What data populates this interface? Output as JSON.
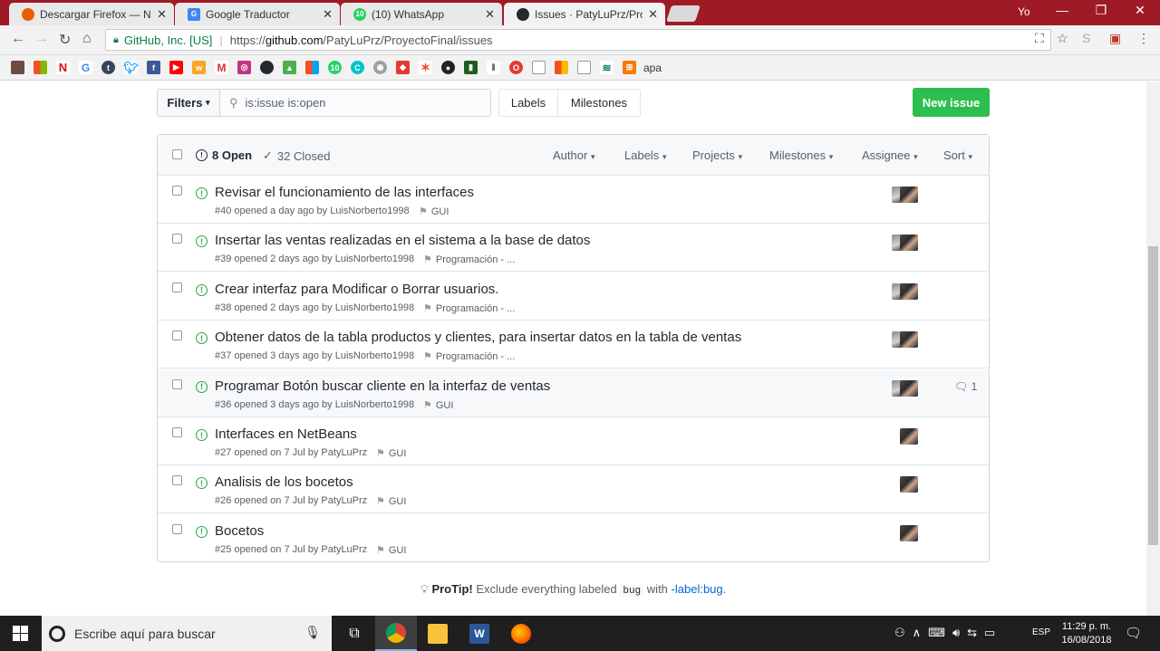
{
  "browser": {
    "tabs": [
      {
        "title": "Descargar Firefox — Nav",
        "icon": "firefox-icon",
        "color": "#e66000"
      },
      {
        "title": "Google Traductor",
        "icon": "google-translate-icon",
        "color": "#4285f4"
      },
      {
        "title": "(10) WhatsApp",
        "icon": "whatsapp-icon",
        "color": "#25d366"
      },
      {
        "title": "Issues · PatyLuPrz/Proyec",
        "icon": "github-icon",
        "color": "#24292e"
      }
    ],
    "profile": "Yo",
    "security_label": "GitHub, Inc. [US]",
    "url_prefix": "https://",
    "url_host": "github.com",
    "url_path": "/PatyLuPrz/ProyectoFinal/issues",
    "bookmarks_last": "apa"
  },
  "toolbar": {
    "filters_label": "Filters",
    "search_value": "is:issue is:open",
    "labels_label": "Labels",
    "milestones_label": "Milestones",
    "new_issue_label": "New issue"
  },
  "list_header": {
    "open_label": "8 Open",
    "closed_label": "32 Closed",
    "filters": [
      "Author",
      "Labels",
      "Projects",
      "Milestones",
      "Assignee",
      "Sort"
    ]
  },
  "issues": [
    {
      "title": "Revisar el funcionamiento de las interfaces",
      "meta": "#40 opened a day ago by LuisNorberto1998",
      "milestone": "GUI",
      "two_avatars": true,
      "comments": ""
    },
    {
      "title": "Insertar las ventas realizadas en el sistema a la base de datos",
      "meta": "#39 opened 2 days ago by LuisNorberto1998",
      "milestone": "Programación - ...",
      "two_avatars": true,
      "comments": ""
    },
    {
      "title": "Crear interfaz para Modificar o Borrar usuarios.",
      "meta": "#38 opened 2 days ago by LuisNorberto1998",
      "milestone": "Programación - ...",
      "two_avatars": true,
      "comments": ""
    },
    {
      "title": "Obtener datos de la tabla productos y clientes, para insertar datos en la tabla de ventas",
      "meta": "#37 opened 3 days ago by LuisNorberto1998",
      "milestone": "Programación - ...",
      "two_avatars": true,
      "comments": ""
    },
    {
      "title": "Programar Botón buscar cliente en la interfaz de ventas",
      "meta": "#36 opened 3 days ago by LuisNorberto1998",
      "milestone": "GUI",
      "two_avatars": true,
      "comments": "1"
    },
    {
      "title": "Interfaces en NetBeans",
      "meta": "#27 opened on 7 Jul by PatyLuPrz",
      "milestone": "GUI",
      "two_avatars": false,
      "comments": ""
    },
    {
      "title": "Analisis de los bocetos",
      "meta": "#26 opened on 7 Jul by PatyLuPrz",
      "milestone": "GUI",
      "two_avatars": false,
      "comments": ""
    },
    {
      "title": "Bocetos",
      "meta": "#25 opened on 7 Jul by PatyLuPrz",
      "milestone": "GUI",
      "two_avatars": false,
      "comments": ""
    }
  ],
  "protip": {
    "label": "ProTip!",
    "text": "Exclude everything labeled",
    "code": "bug",
    "with": "with",
    "link": "-label:bug",
    "end": "."
  },
  "taskbar": {
    "search_placeholder": "Escribe aquí para buscar",
    "lang": "ESP",
    "time": "11:29 p. m.",
    "date": "16/08/2018"
  }
}
